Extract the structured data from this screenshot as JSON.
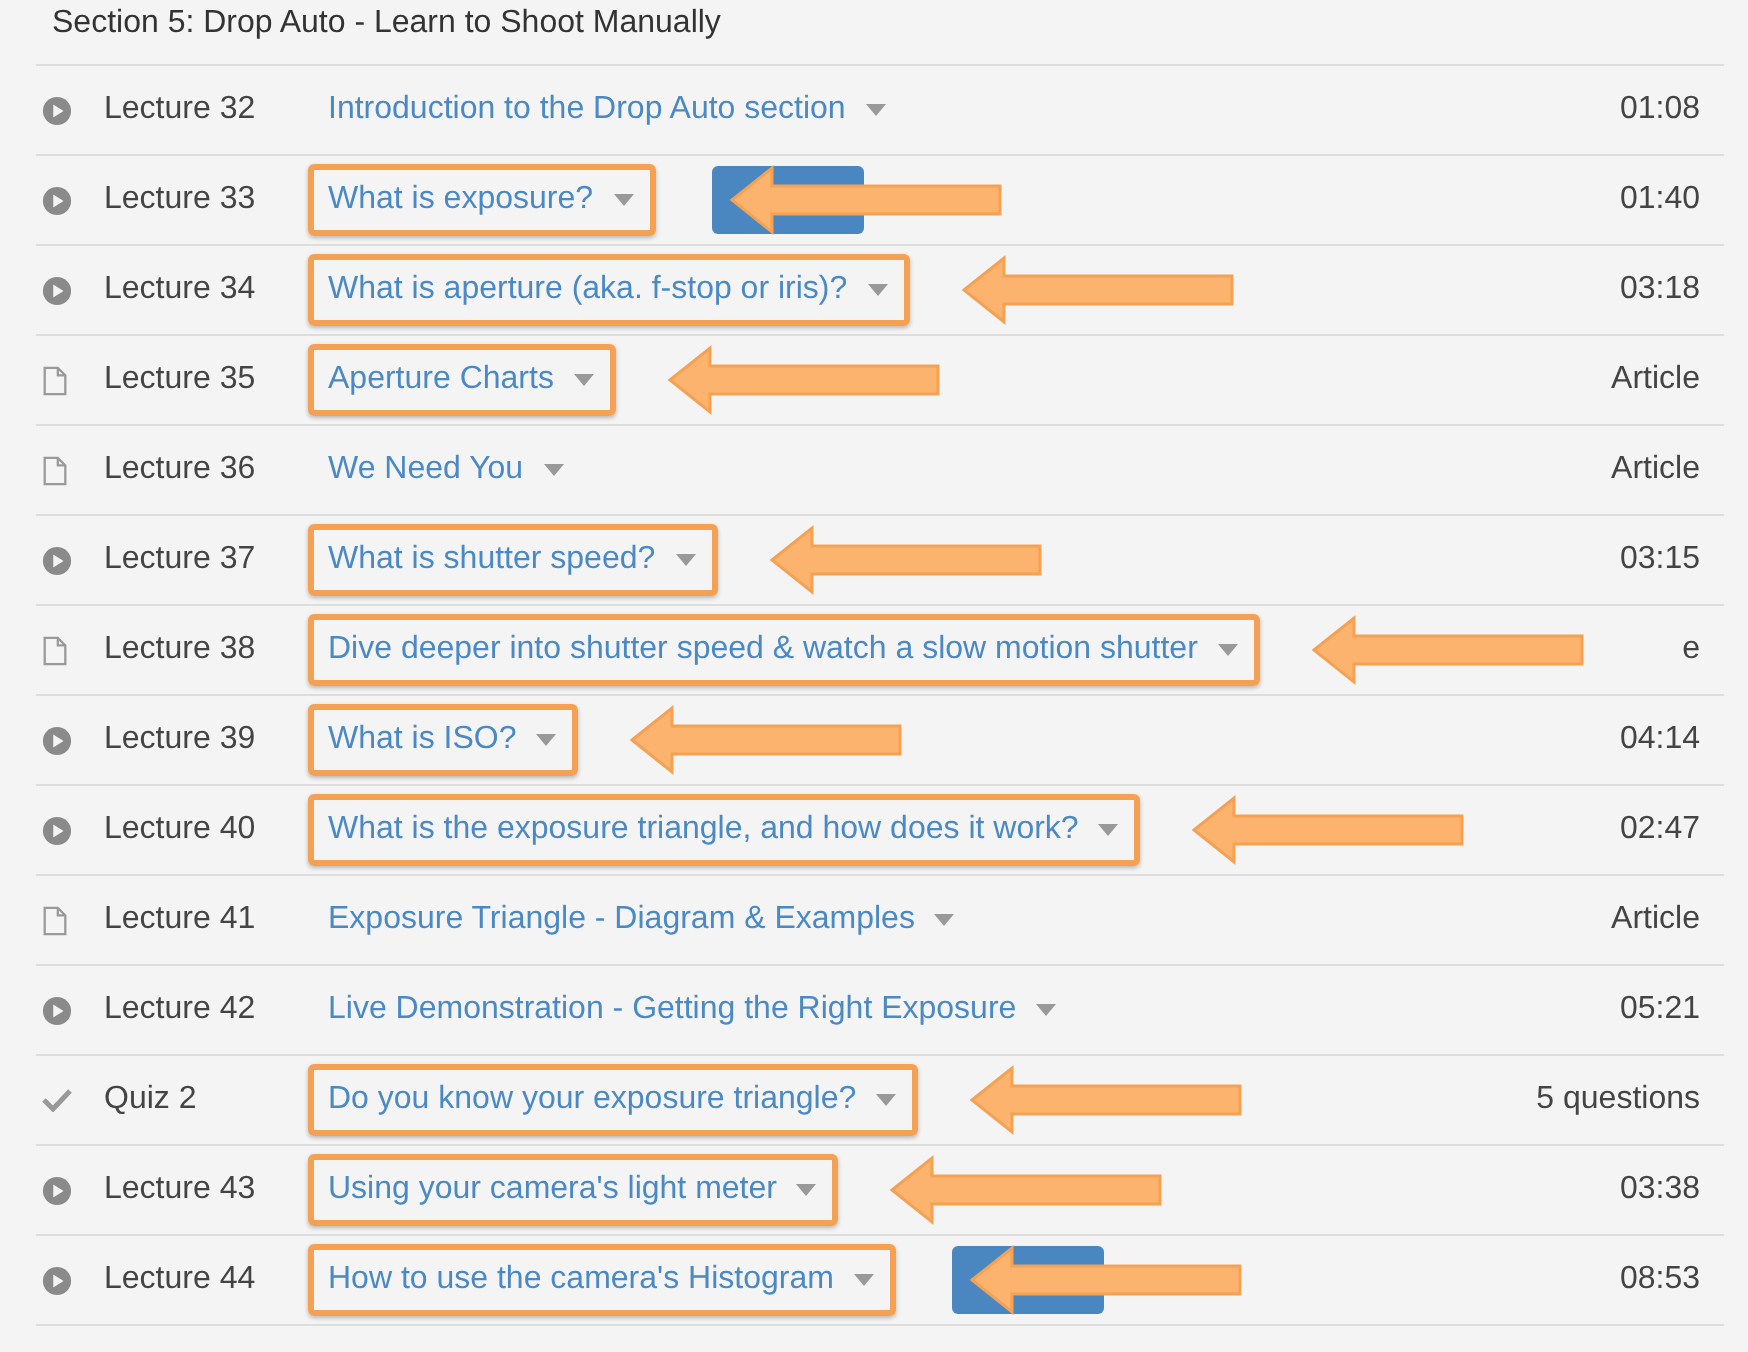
{
  "section_title": "Section 5: Drop Auto - Learn to Shoot Manually",
  "rows": [
    {
      "kind": "video",
      "label": "Lecture 32",
      "title": "Introduction to the Drop Auto section",
      "duration": "01:08",
      "highlighted": false,
      "arrow": false,
      "button": false
    },
    {
      "kind": "video",
      "label": "Lecture 33",
      "title": "What is exposure?",
      "duration": "01:40",
      "highlighted": true,
      "arrow": true,
      "button": true
    },
    {
      "kind": "video",
      "label": "Lecture 34",
      "title": "What is aperture (aka. f-stop or iris)?",
      "duration": "03:18",
      "highlighted": true,
      "arrow": true,
      "button": false
    },
    {
      "kind": "article",
      "label": "Lecture 35",
      "title": "Aperture Charts",
      "duration": "Article",
      "highlighted": true,
      "arrow": true,
      "button": false
    },
    {
      "kind": "article",
      "label": "Lecture 36",
      "title": "We Need You",
      "duration": "Article",
      "highlighted": false,
      "arrow": false,
      "button": false
    },
    {
      "kind": "video",
      "label": "Lecture 37",
      "title": "What is shutter speed?",
      "duration": "03:15",
      "highlighted": true,
      "arrow": true,
      "button": false
    },
    {
      "kind": "article",
      "label": "Lecture 38",
      "title": "Dive deeper into shutter speed & watch a slow motion shutter",
      "duration": "e",
      "highlighted": true,
      "arrow": true,
      "button": false
    },
    {
      "kind": "video",
      "label": "Lecture 39",
      "title": "What is ISO?",
      "duration": "04:14",
      "highlighted": true,
      "arrow": true,
      "button": false
    },
    {
      "kind": "video",
      "label": "Lecture 40",
      "title": "What is the exposure triangle, and how does it work?",
      "duration": "02:47",
      "highlighted": true,
      "arrow": true,
      "button": false
    },
    {
      "kind": "article",
      "label": "Lecture 41",
      "title": "Exposure Triangle - Diagram & Examples",
      "duration": "Article",
      "highlighted": false,
      "arrow": false,
      "button": false
    },
    {
      "kind": "video",
      "label": "Lecture 42",
      "title": "Live Demonstration - Getting the Right Exposure",
      "duration": "05:21",
      "highlighted": false,
      "arrow": false,
      "button": false
    },
    {
      "kind": "quiz",
      "label": "Quiz 2",
      "title": "Do you know your exposure triangle?",
      "duration": "5 questions",
      "highlighted": true,
      "arrow": true,
      "button": false
    },
    {
      "kind": "video",
      "label": "Lecture 43",
      "title": "Using your camera's light meter",
      "duration": "03:38",
      "highlighted": true,
      "arrow": true,
      "button": false
    },
    {
      "kind": "video",
      "label": "Lecture 44",
      "title": "How to use the camera's Histogram",
      "duration": "08:53",
      "highlighted": true,
      "arrow": true,
      "button": true
    }
  ]
}
